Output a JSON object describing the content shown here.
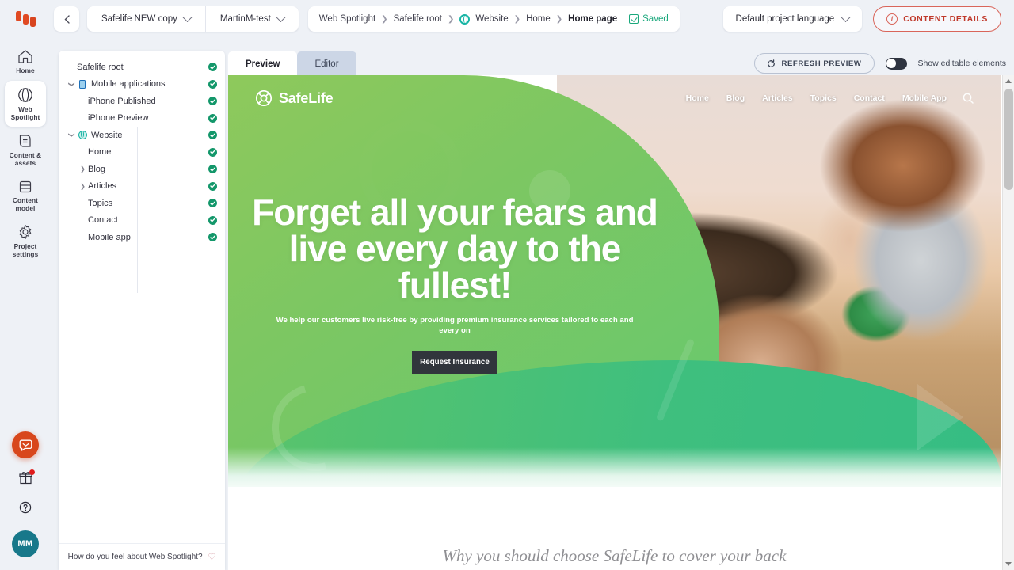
{
  "app": {
    "brand_icon": "kontent-logo-icon"
  },
  "topbar": {
    "back_icon": "chevron-left-icon",
    "project_selector": "Safelife NEW copy",
    "environment_selector": "MartinM-test",
    "breadcrumb": [
      {
        "label": "Web Spotlight",
        "icon": null
      },
      {
        "label": "Safelife root",
        "icon": null
      },
      {
        "label": "Website",
        "icon": "web-globe-icon"
      },
      {
        "label": "Home",
        "icon": null
      },
      {
        "label": "Home page",
        "icon": null,
        "current": true
      }
    ],
    "saved_label": "Saved",
    "saved_icon": "checkbox-checked-icon",
    "language_selector": "Default project language",
    "content_details_label": "CONTENT DETAILS",
    "content_details_icon": "info-icon"
  },
  "rail": {
    "items": [
      {
        "label": "Home",
        "icon": "home-icon",
        "active": false
      },
      {
        "label": "Web Spotlight",
        "icon": "globe-icon",
        "active": true
      },
      {
        "label": "Content & assets",
        "icon": "content-assets-icon",
        "active": false
      },
      {
        "label": "Content model",
        "icon": "content-model-icon",
        "active": false
      },
      {
        "label": "Project settings",
        "icon": "gear-icon",
        "active": false
      }
    ],
    "bottom": {
      "feedback_icon": "chat-bubble-icon",
      "gift_icon": "gift-icon",
      "help_icon": "question-mark-icon",
      "avatar_initials": "MM"
    }
  },
  "tree": {
    "rows": [
      {
        "label": "Safelife root",
        "depth": 0,
        "toggle": "none",
        "icon": null,
        "status": "published"
      },
      {
        "label": "Mobile applications",
        "depth": 0,
        "toggle": "open",
        "icon": "mobile-icon",
        "status": "published"
      },
      {
        "label": "iPhone Published",
        "depth": 1,
        "toggle": "none",
        "icon": null,
        "status": "published"
      },
      {
        "label": "iPhone Preview",
        "depth": 1,
        "toggle": "none",
        "icon": null,
        "status": "published"
      },
      {
        "label": "Website",
        "depth": 0,
        "toggle": "open",
        "icon": "web-icon",
        "status": "published"
      },
      {
        "label": "Home",
        "depth": 1,
        "toggle": "none",
        "icon": null,
        "status": "published"
      },
      {
        "label": "Blog",
        "depth": 1,
        "toggle": "closed",
        "icon": null,
        "status": "published"
      },
      {
        "label": "Articles",
        "depth": 1,
        "toggle": "closed",
        "icon": null,
        "status": "published"
      },
      {
        "label": "Topics",
        "depth": 1,
        "toggle": "none",
        "icon": null,
        "status": "published"
      },
      {
        "label": "Contact",
        "depth": 1,
        "toggle": "none",
        "icon": null,
        "status": "published"
      },
      {
        "label": "Mobile app",
        "depth": 1,
        "toggle": "none",
        "icon": null,
        "status": "published"
      }
    ],
    "footer_text": "How do you feel about Web Spotlight?",
    "footer_icon": "heart-icon"
  },
  "preview": {
    "tabs": [
      {
        "label": "Preview",
        "active": true
      },
      {
        "label": "Editor",
        "active": false
      }
    ],
    "refresh_label": "REFRESH PREVIEW",
    "refresh_icon": "refresh-icon",
    "toggle_label": "Show editable elements",
    "toggle_on": false,
    "scrollbar": {
      "up_icon": "triangle-up-icon",
      "down_icon": "triangle-down-icon"
    }
  },
  "website": {
    "logo_name": "SafeLife",
    "logo_icon": "lifebuoy-icon",
    "menu": [
      "Home",
      "Blog",
      "Articles",
      "Topics",
      "Contact",
      "Mobile App"
    ],
    "search_icon": "search-icon",
    "hero_title": "Forget all your fears and live every day to the fullest!",
    "hero_subtitle": "We help our customers live risk-free by providing premium insurance services tailored to each and every on",
    "cta_label": "Request Insurance",
    "section_heading": "Why you should choose SafeLife to cover your back"
  },
  "colors": {
    "accent_red": "#c0392b",
    "brand_orange": "#d8471c",
    "status_green": "#13976a",
    "hero_green_top": "#8ec95c",
    "hero_green_bottom": "#35bd84",
    "avatar_teal": "#17788a"
  }
}
